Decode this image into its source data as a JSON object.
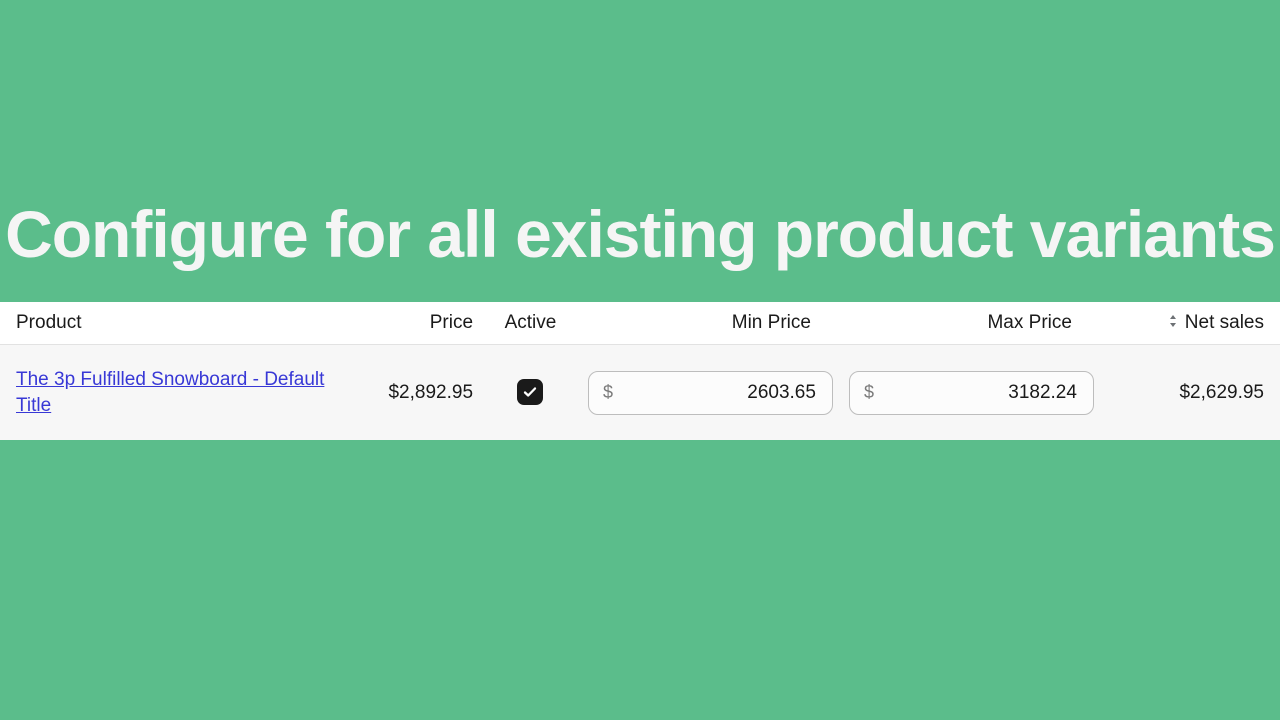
{
  "hero": {
    "title": "Configure for all existing product variants"
  },
  "table": {
    "headers": {
      "product": "Product",
      "price": "Price",
      "active": "Active",
      "minprice": "Min Price",
      "maxprice": "Max Price",
      "netsales": "Net sales"
    },
    "rows": [
      {
        "product": "The 3p Fulfilled Snowboard - Default Title",
        "price": "$2,892.95",
        "active": true,
        "currency": "$",
        "minprice": "2603.65",
        "maxprice": "3182.24",
        "netsales": "$2,629.95"
      }
    ]
  }
}
